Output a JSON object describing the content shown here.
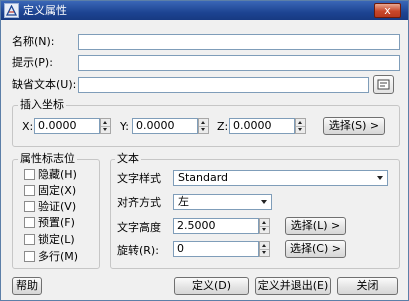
{
  "window": {
    "title": "定义属性",
    "close_symbol": "x"
  },
  "attribute": {
    "tag_label": "名称(N):",
    "tag_value": "",
    "prompt_label": "提示(P):",
    "prompt_value": "",
    "default_label": "缺省文本(U):",
    "default_value": ""
  },
  "insertion": {
    "legend": "插入坐标",
    "x_label": "X:",
    "x_value": "0.0000",
    "y_label": "Y:",
    "y_value": "0.0000",
    "z_label": "Z:",
    "z_value": "0.0000",
    "pick_label": "选择(S) >"
  },
  "mode": {
    "legend": "属性标志位",
    "items": [
      {
        "label": "隐藏(H)",
        "checked": false
      },
      {
        "label": "固定(X)",
        "checked": false
      },
      {
        "label": "验证(V)",
        "checked": false
      },
      {
        "label": "预置(F)",
        "checked": false
      },
      {
        "label": "锁定(L)",
        "checked": false
      },
      {
        "label": "多行(M)",
        "checked": false
      }
    ]
  },
  "text": {
    "legend": "文本",
    "style_label": "文字样式",
    "style_value": "Standard",
    "justify_label": "对齐方式",
    "justify_value": "左",
    "height_label": "文字高度",
    "height_value": "2.5000",
    "height_pick": "选择(L) >",
    "rotation_label": "旋转(R):",
    "rotation_value": "0",
    "rotation_pick": "选择(C) >"
  },
  "buttons": {
    "help": "帮助",
    "define": "定义(D)",
    "define_exit": "定义并退出(E)",
    "close": "关闭"
  }
}
